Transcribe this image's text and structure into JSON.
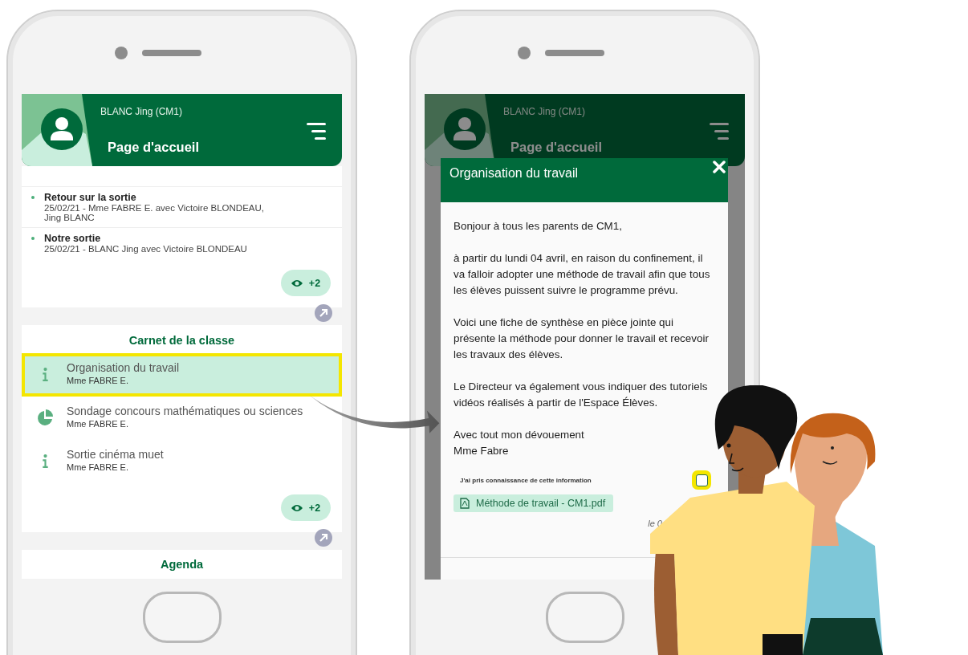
{
  "home_screen": {
    "header": {
      "user": "BLANC Jing (CM1)",
      "title": "Page d'accueil"
    },
    "news": {
      "items": [
        {
          "title": "Retour sur la sortie",
          "subtitle": "25/02/21 - Mme FABRE E. avec Victoire BLONDEAU, Jing BLANC"
        },
        {
          "title": "Notre sortie",
          "subtitle": "25/02/21 - BLANC Jing avec Victoire BLONDEAU"
        }
      ],
      "more": "+2"
    },
    "carnet": {
      "title": "Carnet de la classe",
      "items": [
        {
          "kind": "info",
          "title": "Organisation du travail",
          "subtitle": "Mme FABRE E.",
          "selected": true,
          "highlighted": true
        },
        {
          "kind": "poll",
          "title": "Sondage concours mathématiques ou sciences",
          "subtitle": "Mme FABRE E.",
          "selected": false,
          "highlighted": false
        },
        {
          "kind": "info",
          "title": "Sortie cinéma muet",
          "subtitle": "Mme FABRE E.",
          "selected": false,
          "highlighted": false
        }
      ],
      "more": "+2"
    },
    "agenda": {
      "title": "Agenda"
    }
  },
  "message_screen": {
    "header": {
      "user": "BLANC Jing (CM1)",
      "title": "Page d'accueil"
    },
    "dialog": {
      "title": "Organisation du travail",
      "paragraphs": [
        "Bonjour à tous les parents de CM1,",
        "à partir du lundi 04 avril, en raison du confinement, il va falloir adopter une méthode de travail afin que tous les élèves puissent suivre le programme prévu.",
        "Voici une fiche de synthèse en pièce jointe qui présente la méthode pour donner le travail et recevoir les travaux des élèves.",
        "Le Directeur va également vous indiquer des tutoriels vidéos réalisés à partir de l'Espace Élèves.",
        "Avec tout mon dévouement\nMme Fabre"
      ],
      "acknowledgement": {
        "label": "J'ai pris connaissance de cette information",
        "checked": false,
        "highlighted": true
      },
      "attachment": "Méthode de travail - CM1.pdf",
      "date": "le 0"
    }
  }
}
